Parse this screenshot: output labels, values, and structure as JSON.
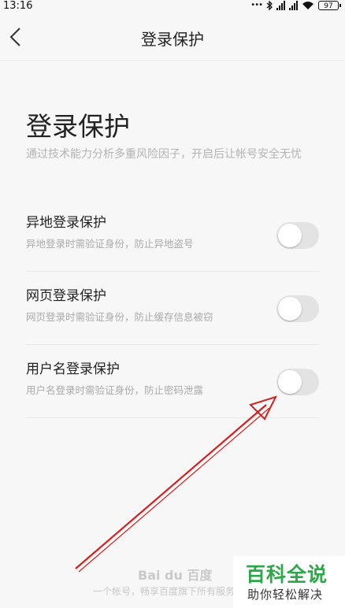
{
  "status_bar": {
    "time": "13:16",
    "battery": "97"
  },
  "nav": {
    "title": "登录保护"
  },
  "header": {
    "title": "登录保护",
    "description": "通过技术能力分析多重风险因子，开启后让帐号安全无忧"
  },
  "settings": [
    {
      "title": "异地登录保护",
      "subtitle": "异地登录时需验证身份，防止异地盗号",
      "enabled": false
    },
    {
      "title": "网页登录保护",
      "subtitle": "网页登录时需验证身份，防止缓存信息被窃",
      "enabled": false
    },
    {
      "title": "用户名登录保护",
      "subtitle": "用户名登录时需验证身份，防止密码泄露",
      "enabled": false
    }
  ],
  "footer": {
    "logo": "Bai du 百度",
    "text": "一个帐号，畅享百度旗下所有服务"
  },
  "brand": {
    "title": "百科全说",
    "subtitle": "助你轻松解决"
  },
  "colors": {
    "brand_green": "#2ca84a",
    "annotation_arrow": "#d42020",
    "toggle_off": "#e3e3e3"
  }
}
